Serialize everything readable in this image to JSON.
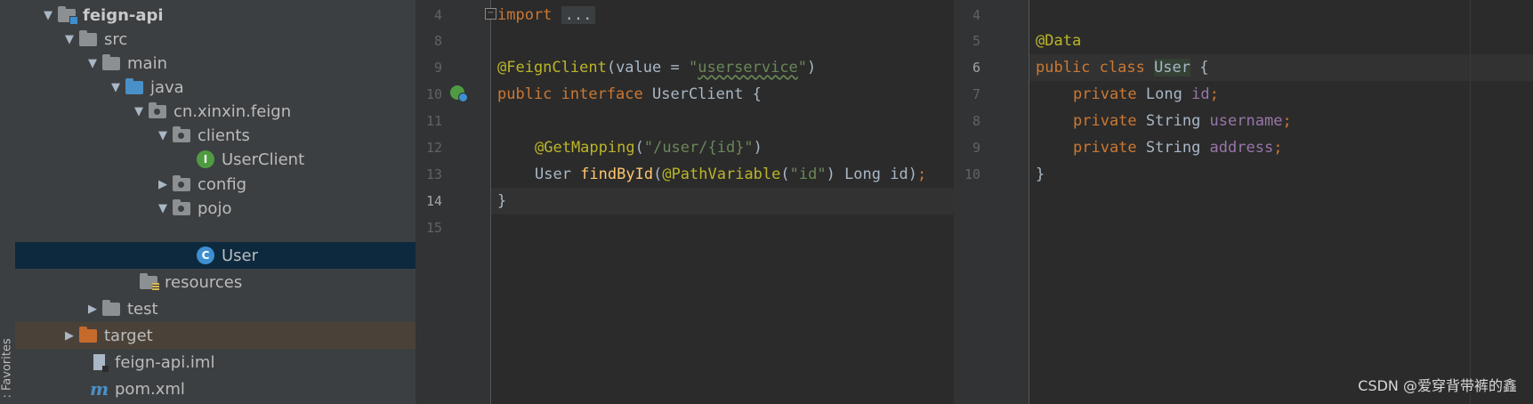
{
  "sidebar": {
    "favorites_label": ": Favorites"
  },
  "project_tree": {
    "items": [
      {
        "label": "feign-api",
        "arrow": "▼",
        "icon": "module-folder-icon"
      },
      {
        "label": "src",
        "arrow": "▼",
        "icon": "folder-icon"
      },
      {
        "label": "main",
        "arrow": "▼",
        "icon": "folder-icon"
      },
      {
        "label": "java",
        "arrow": "▼",
        "icon": "source-folder-icon"
      },
      {
        "label": "cn.xinxin.feign",
        "arrow": "▼",
        "icon": "package-icon"
      },
      {
        "label": "clients",
        "arrow": "▼",
        "icon": "package-icon"
      },
      {
        "label": "UserClient",
        "arrow": "",
        "icon": "interface-icon",
        "badge": "I"
      },
      {
        "label": "config",
        "arrow": "▶",
        "icon": "package-icon"
      },
      {
        "label": "pojo",
        "arrow": "▼",
        "icon": "package-icon"
      },
      {
        "label": "User",
        "arrow": "",
        "icon": "class-icon",
        "badge": "C"
      },
      {
        "label": "resources",
        "arrow": "",
        "icon": "resources-folder-icon"
      },
      {
        "label": "test",
        "arrow": "▶",
        "icon": "folder-icon"
      },
      {
        "label": "target",
        "arrow": "▶",
        "icon": "excluded-folder-icon"
      },
      {
        "label": "feign-api.iml",
        "arrow": "",
        "icon": "iml-file-icon"
      },
      {
        "label": "pom.xml",
        "arrow": "",
        "icon": "maven-icon",
        "badge": "m"
      }
    ]
  },
  "editor_left": {
    "file": "UserClient",
    "line_numbers": [
      "4",
      "8",
      "9",
      "10",
      "11",
      "12",
      "13",
      "14",
      "15"
    ],
    "current_line": "14",
    "code": {
      "l4_kw": "import",
      "l4_fold": "...",
      "l9_ann": "@FeignClient",
      "l9_open": "(value = ",
      "l9_str_q1": "\"",
      "l9_str": "userservice",
      "l9_str_q2": "\"",
      "l9_close": ")",
      "l10_kw": "public interface ",
      "l10_rest": "UserClient {",
      "l12_ann": "@GetMapping",
      "l12_open": "(",
      "l12_str": "\"/user/{id}\"",
      "l12_close": ")",
      "l13_type": "User ",
      "l13_fn": "findById",
      "l13_p1": "(",
      "l13_ann": "@PathVariable",
      "l13_p2": "(",
      "l13_str": "\"id\"",
      "l13_p3": ") Long id)",
      "l13_semi": ";",
      "l14_brace": "}"
    }
  },
  "editor_right": {
    "file": "User",
    "line_numbers": [
      "4",
      "5",
      "6",
      "7",
      "8",
      "9",
      "10"
    ],
    "current_line": "6",
    "code": {
      "l5_ann": "@Data",
      "l6_kw": "public class ",
      "l6_cls": "User",
      "l6_brace": " {",
      "l7_kw": "private ",
      "l7_type": "Long ",
      "l7_fld": "id",
      "l8_kw": "private ",
      "l8_type": "String ",
      "l8_fld": "username",
      "l9_kw": "private ",
      "l9_type": "String ",
      "l9_fld": "address",
      "semi": ";",
      "l10_brace": "}"
    }
  },
  "watermark": "CSDN @爱穿背带裤的鑫",
  "colors": {
    "keyword": "#cc7832",
    "annotation": "#bbb529",
    "string": "#6a8759",
    "field": "#9876aa",
    "method": "#ffc66d",
    "selection": "#0d293e"
  }
}
